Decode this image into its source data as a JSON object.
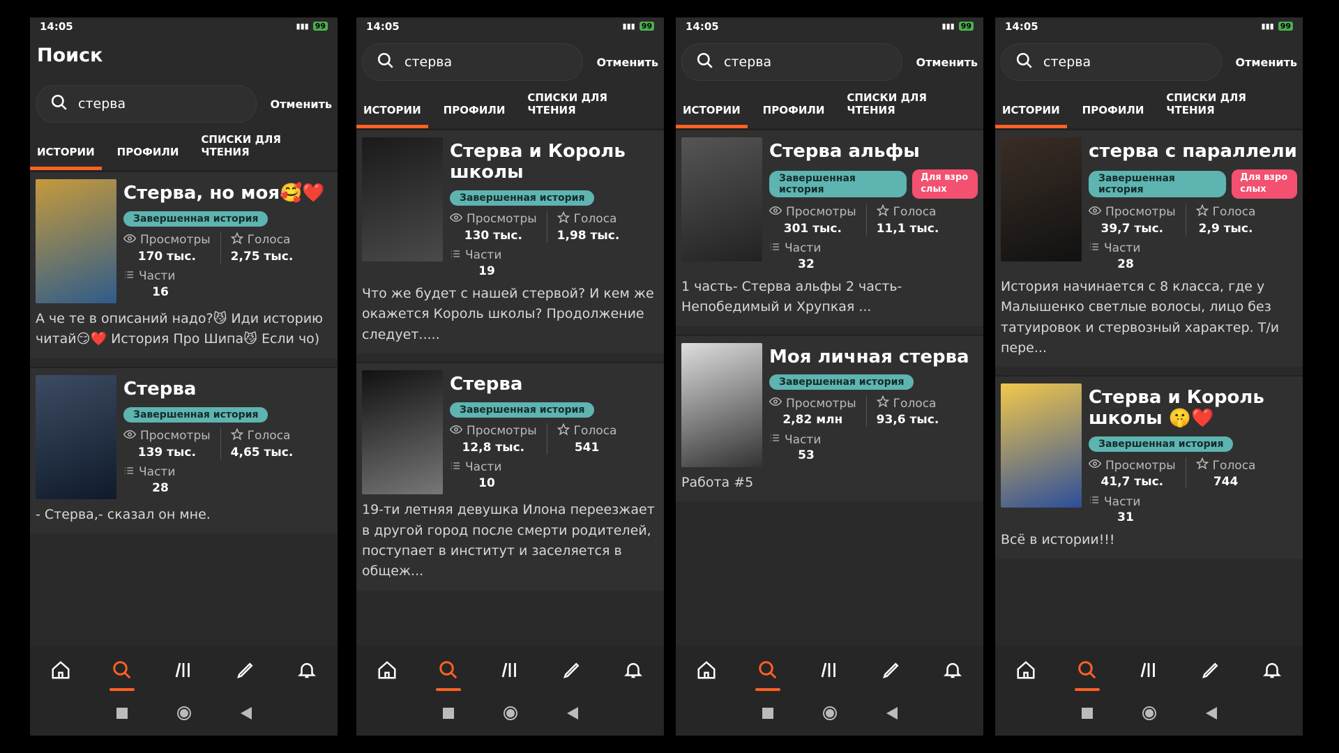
{
  "status": {
    "time": "14:05",
    "battery": "99"
  },
  "common": {
    "search_title": "Поиск",
    "search_value": "стерва",
    "cancel_label": "Отменить",
    "tabs": [
      "ИСТОРИИ",
      "ПРОФИЛИ",
      "СПИСКИ ДЛЯ ЧТЕНИЯ"
    ],
    "views_label": "Просмотры",
    "votes_label": "Голоса",
    "parts_label": "Части",
    "complete_label": "Завершенная история",
    "mature_label": "Для взро слых"
  },
  "colors": {
    "accent": "#ff6122",
    "complete": "#5eb4b0",
    "mature": "#f4506f"
  },
  "phones": [
    {
      "cards": [
        {
          "title": "Стерва, но моя🥰❤️",
          "views": "170 тыс.",
          "votes": "2,75 тыс.",
          "parts": "16",
          "mature": false,
          "desc": "А че те в описаний надо?😼 Иди историю читай😏❤️ История Про Шипа😼 Если чо)"
        },
        {
          "title": "Стерва",
          "views": "139 тыс.",
          "votes": "4,65 тыс.",
          "parts": "28",
          "mature": false,
          "desc": "- Стерва,- сказал он мне."
        }
      ]
    },
    {
      "cards": [
        {
          "title": "Стерва и Король школы",
          "views": "130 тыс.",
          "votes": "1,98 тыс.",
          "parts": "19",
          "mature": false,
          "desc": "Что же будет с нашей стервой? И кем же окажется Король школы? Продолжение следует....."
        },
        {
          "title": "Стерва",
          "views": "12,8 тыс.",
          "votes": "541",
          "parts": "10",
          "mature": false,
          "desc": "19-ти летняя девушка Илона переезжает в другой город после смерти родителей, поступает в институт и заселяется в общеж..."
        }
      ]
    },
    {
      "cards": [
        {
          "title": "Стерва альфы",
          "views": "301 тыс.",
          "votes": "11,1 тыс.",
          "parts": "32",
          "mature": true,
          "desc": "1 часть- Стерва альфы 2 часть- Непобедимый и Хрупкая ..."
        },
        {
          "title": "Моя личная стерва",
          "views": "2,82 млн",
          "votes": "93,6 тыс.",
          "parts": "53",
          "mature": false,
          "desc": "Работа #5"
        }
      ]
    },
    {
      "cards": [
        {
          "title": "стерва с параллели",
          "views": "39,7 тыс.",
          "votes": "2,9 тыс.",
          "parts": "28",
          "mature": true,
          "desc": "История начинается с 8 класса, где у Малышенко светлые волосы, лицо без татуировок и стервозный характер. Т/и пере..."
        },
        {
          "title": "Стерва и Король школы 🤫❤️",
          "views": "41,7 тыс.",
          "votes": "744",
          "parts": "31",
          "mature": false,
          "desc": "Всё в истории!!!"
        }
      ]
    }
  ]
}
